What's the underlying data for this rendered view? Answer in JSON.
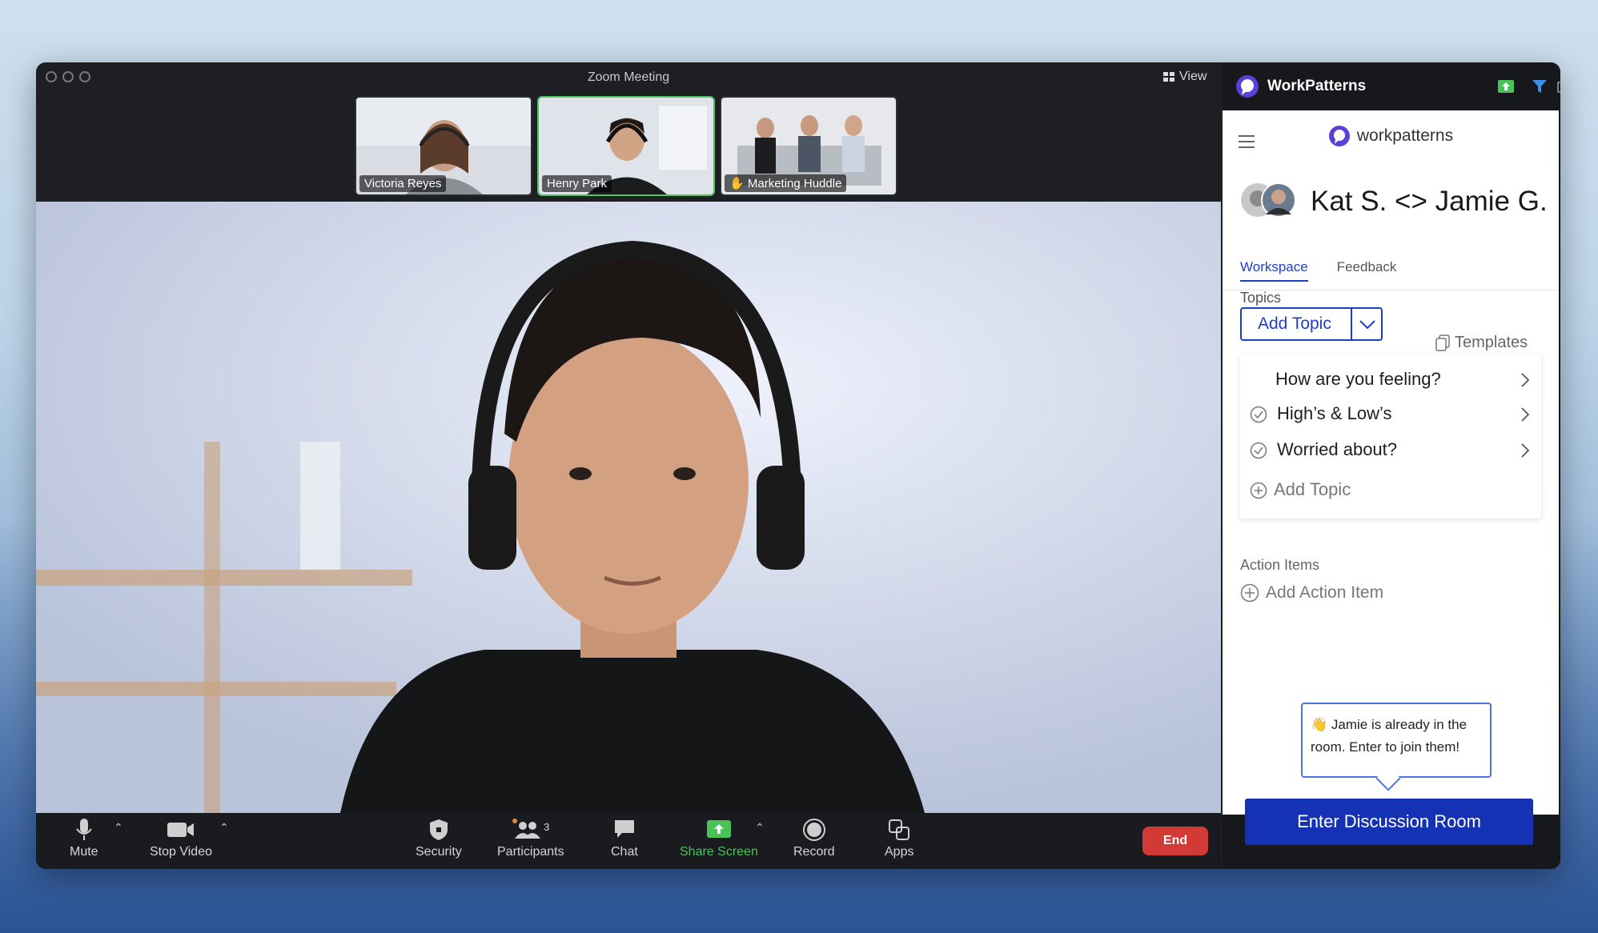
{
  "window": {
    "title": "Zoom Meeting",
    "view_label": "View"
  },
  "thumbnails": [
    {
      "name": "Victoria Reyes",
      "active": false
    },
    {
      "name": "Henry Park",
      "active": true
    },
    {
      "name": "Marketing Huddle",
      "active": false
    }
  ],
  "toolbar": {
    "mute": "Mute",
    "stop_video": "Stop Video",
    "security": "Security",
    "participants": "Participants",
    "participants_count": "3",
    "chat": "Chat",
    "share_screen": "Share Screen",
    "record": "Record",
    "apps": "Apps",
    "end": "End"
  },
  "panel": {
    "app_name": "WorkPatterns",
    "brand_name": "workpatterns",
    "meeting_title": "Kat S. <> Jamie G.",
    "tabs": [
      "Workspace",
      "Feedback"
    ],
    "topics_label": "Topics",
    "templates_label": "Templates",
    "add_topic_button": "Add Topic",
    "topics": [
      {
        "label": "How are you feeling?",
        "checked": false
      },
      {
        "label": "High’s & Low’s",
        "checked": true
      },
      {
        "label": "Worried about?",
        "checked": true
      }
    ],
    "add_topic_link": "Add Topic",
    "action_items_label": "Action Items",
    "add_action_item": "Add Action Item",
    "tooltip_emoji": "👋",
    "tooltip_text": "Jamie is already in the room. Enter to join them!",
    "enter_button": "Enter Discussion Room"
  },
  "colors": {
    "accent": "#1f3ec7",
    "end": "#d23a35",
    "share": "#49c25a"
  }
}
